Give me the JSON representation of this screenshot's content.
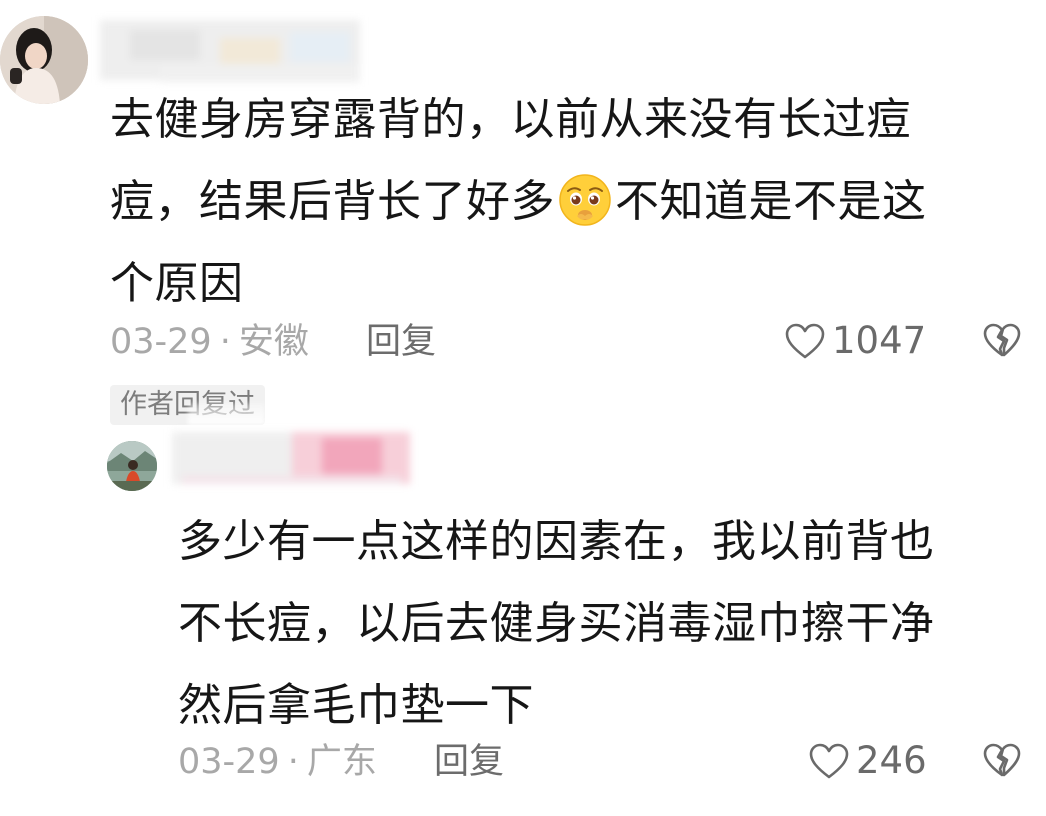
{
  "comment": {
    "text_lines": [
      "去健身房穿露背的，以前从来没有长过痘",
      "痘，结果后背长了好多",
      "不知道是不是这",
      "个原因"
    ],
    "emoji": "pleading-face-emoji",
    "date": "03-29",
    "separator": "·",
    "location": "安徽",
    "reply_label": "回复",
    "like_count": "1047"
  },
  "author_badge": "作者回复过",
  "reply": {
    "text_lines": [
      "多少有一点这样的因素在，我以前背也",
      "不长痘，以后去健身买消毒湿巾擦干净",
      "然后拿毛巾垫一下"
    ],
    "date": "03-29",
    "separator": "·",
    "location": "广东",
    "reply_label": "回复",
    "like_count": "246"
  },
  "icons": {
    "like": "heart-outline-icon",
    "dislike": "broken-heart-icon"
  },
  "colors": {
    "text": "#161616",
    "meta": "#a8a8a8",
    "action": "#6a6a6a",
    "badge_bg": "#f1f1f1"
  }
}
